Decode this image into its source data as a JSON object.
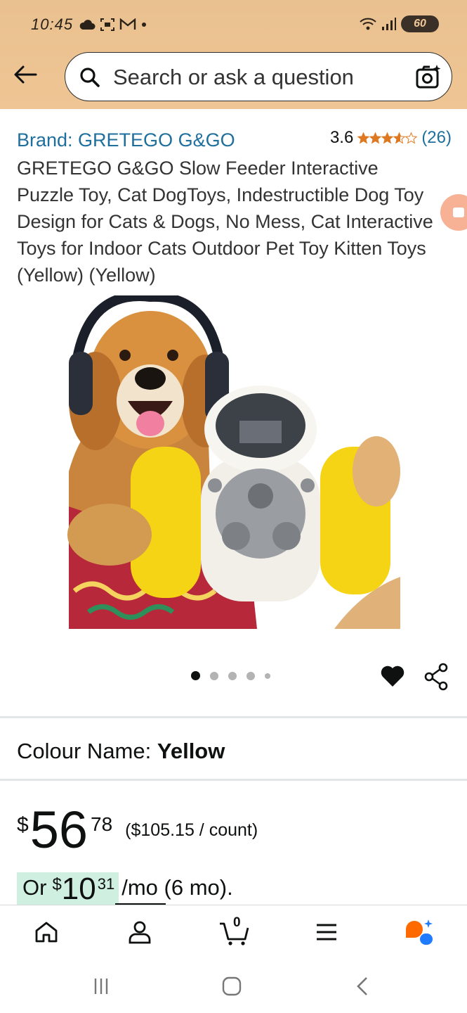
{
  "status_bar": {
    "time": "10:45",
    "battery": "60",
    "left_icons": [
      "cloud-icon",
      "screenshot-icon",
      "gmail-icon",
      "dot-icon"
    ],
    "right_icons": [
      "wifi-icon",
      "signal-icon",
      "battery-icon"
    ]
  },
  "search": {
    "placeholder": "Search or ask a question"
  },
  "product": {
    "brand": "Brand: GRETEGO G&GO",
    "rating_value": "3.6",
    "rating_stars": 3.6,
    "rating_count": "(26)",
    "title": "GRETEGO G&GO Slow Feeder Interactive Puzzle Toy, Cat DogToys, Indestructible Dog Toy Design for Cats & Dogs, No Mess, Cat Interactive Toys for Indoor Cats Outdoor Pet Toy Kitten Toys (Yellow) (Yellow)",
    "image_count": 5,
    "active_image": 0
  },
  "colour": {
    "label": "Colour Name:",
    "value": "Yellow"
  },
  "price": {
    "currency": "$",
    "whole": "56",
    "fraction": "78",
    "unit_price": "($105.15 / count)"
  },
  "monthly": {
    "prefix": "Or",
    "currency": "$",
    "whole": "10",
    "fraction": "31",
    "suffix": "/mo (6 mo)."
  },
  "cart": {
    "count": "0"
  },
  "colors": {
    "header_bg": "#efc594",
    "link": "#1f6f9e",
    "star": "#de7921",
    "highlight": "#cfefe1"
  }
}
